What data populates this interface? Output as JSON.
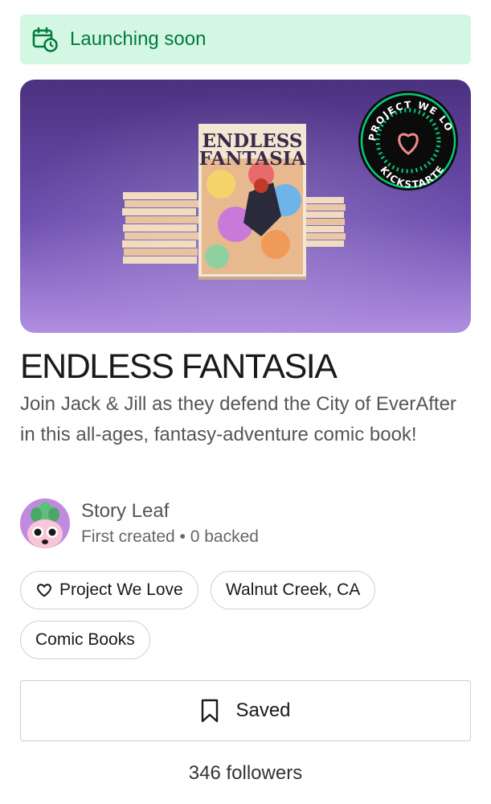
{
  "banner": {
    "text": "Launching soon",
    "icon": "calendar-clock-icon",
    "bg_color": "#d4f7e3",
    "text_color": "#037a3e"
  },
  "hero": {
    "comic_title_line1": "ENDLESS",
    "comic_title_line2": "FANTASIA",
    "badge_top_text": "PROJECT WE LOVE",
    "badge_bottom_text": "KICKSTARTER",
    "bg_color": "#6a4aa8"
  },
  "project": {
    "title": "ENDLESS FANTASIA",
    "blurb": "Join Jack & Jill as they defend the City of EverAfter in this all-ages, fantasy-adventure comic book!"
  },
  "creator": {
    "name": "Story Leaf",
    "meta": "First created • 0 backed"
  },
  "tags": {
    "project_we_love": "Project We Love",
    "location": "Walnut Creek, CA",
    "category": "Comic Books"
  },
  "save": {
    "label": "Saved",
    "icon": "bookmark-icon"
  },
  "followers": {
    "text": "346 followers"
  }
}
